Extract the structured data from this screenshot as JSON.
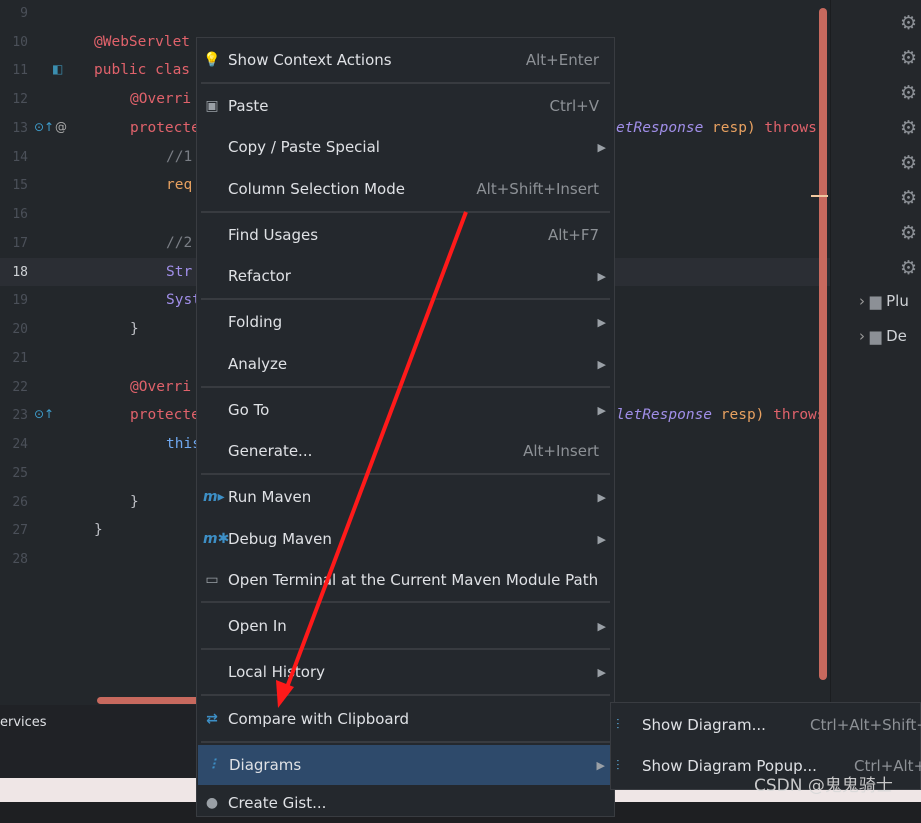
{
  "editor": {
    "line_numbers": [
      "9",
      "10",
      "11",
      "12",
      "13",
      "14",
      "15",
      "16",
      "17",
      "18",
      "19",
      "20",
      "21",
      "22",
      "23",
      "24",
      "25",
      "26",
      "27",
      "28"
    ],
    "current_line": "18",
    "code_left": [
      {
        "line": "10",
        "text": "@WebServlet",
        "cls": "kw",
        "indent": 0
      },
      {
        "line": "11",
        "text": "public clas",
        "cls": "kw",
        "indent": 0
      },
      {
        "line": "12",
        "text": "@Overri",
        "cls": "kw",
        "indent": 1
      },
      {
        "line": "13",
        "text": "protecte",
        "cls": "kw",
        "indent": 1
      },
      {
        "line": "14",
        "text": "//1",
        "cls": "cm",
        "indent": 2
      },
      {
        "line": "15",
        "text": "req",
        "cls": "vr",
        "indent": 2
      },
      {
        "line": "17",
        "text": "//2",
        "cls": "cm",
        "indent": 2
      },
      {
        "line": "18",
        "text": "Str",
        "cls": "ty",
        "indent": 2
      },
      {
        "line": "19",
        "text": "Syst",
        "cls": "ty",
        "indent": 2
      },
      {
        "line": "20",
        "text": "}",
        "cls": "",
        "indent": 1
      },
      {
        "line": "22",
        "text": "@Overri",
        "cls": "kw",
        "indent": 1
      },
      {
        "line": "23",
        "text": "protecte",
        "cls": "kw",
        "indent": 1
      },
      {
        "line": "24",
        "text": "this",
        "cls": "th",
        "indent": 2
      },
      {
        "line": "26",
        "text": "}",
        "cls": "",
        "indent": 1
      },
      {
        "line": "27",
        "text": "}",
        "cls": "",
        "indent": 0
      }
    ],
    "code_right": [
      {
        "line": "13",
        "type": "etResponse",
        "param": " resp) ",
        "kw": "throws"
      },
      {
        "line": "23",
        "type": "letResponse",
        "param": " resp) ",
        "kw": "throws"
      }
    ]
  },
  "right_panel": {
    "tree": [
      {
        "label": "Plu",
        "icon": "plugins-folder-icon"
      },
      {
        "label": "De",
        "icon": "dependencies-folder-icon"
      }
    ]
  },
  "bottom_panel": {
    "tab": "ervices"
  },
  "context_menu": {
    "items": [
      {
        "label": "Show Context Actions",
        "shortcut": "Alt+Enter",
        "icon": "lightbulb-icon"
      },
      {
        "label": "Paste",
        "shortcut": "Ctrl+V",
        "icon": "clipboard-icon"
      },
      {
        "label": "Copy / Paste Special",
        "submenu": true
      },
      {
        "label": "Column Selection Mode",
        "shortcut": "Alt+Shift+Insert"
      },
      {
        "label": "Find Usages",
        "shortcut": "Alt+F7"
      },
      {
        "label": "Refactor",
        "submenu": true
      },
      {
        "label": "Folding",
        "submenu": true
      },
      {
        "label": "Analyze",
        "submenu": true
      },
      {
        "label": "Go To",
        "submenu": true
      },
      {
        "label": "Generate...",
        "shortcut": "Alt+Insert"
      },
      {
        "label": "Run Maven",
        "submenu": true,
        "icon": "maven-run-icon"
      },
      {
        "label": "Debug Maven",
        "submenu": true,
        "icon": "maven-debug-icon"
      },
      {
        "label": "Open Terminal at the Current Maven Module Path",
        "icon": "terminal-maven-icon"
      },
      {
        "label": "Open In",
        "submenu": true
      },
      {
        "label": "Local History",
        "submenu": true
      },
      {
        "label": "Compare with Clipboard",
        "icon": "compare-clipboard-icon"
      },
      {
        "label": "Diagrams",
        "submenu": true,
        "icon": "diagram-icon",
        "selected": true
      },
      {
        "label": "Create Gist...",
        "icon": "github-icon"
      }
    ]
  },
  "submenu": {
    "items": [
      {
        "label": "Show Diagram...",
        "shortcut": "Ctrl+Alt+Shift+U"
      },
      {
        "label": "Show Diagram Popup...",
        "shortcut": "Ctrl+Alt+U"
      }
    ]
  },
  "watermark": "CSDN @鬼鬼骑士",
  "colors": {
    "accent_selection": "#2e4a6b",
    "arrow": "#ff1a1a",
    "scrollbar": "#c7695e"
  }
}
